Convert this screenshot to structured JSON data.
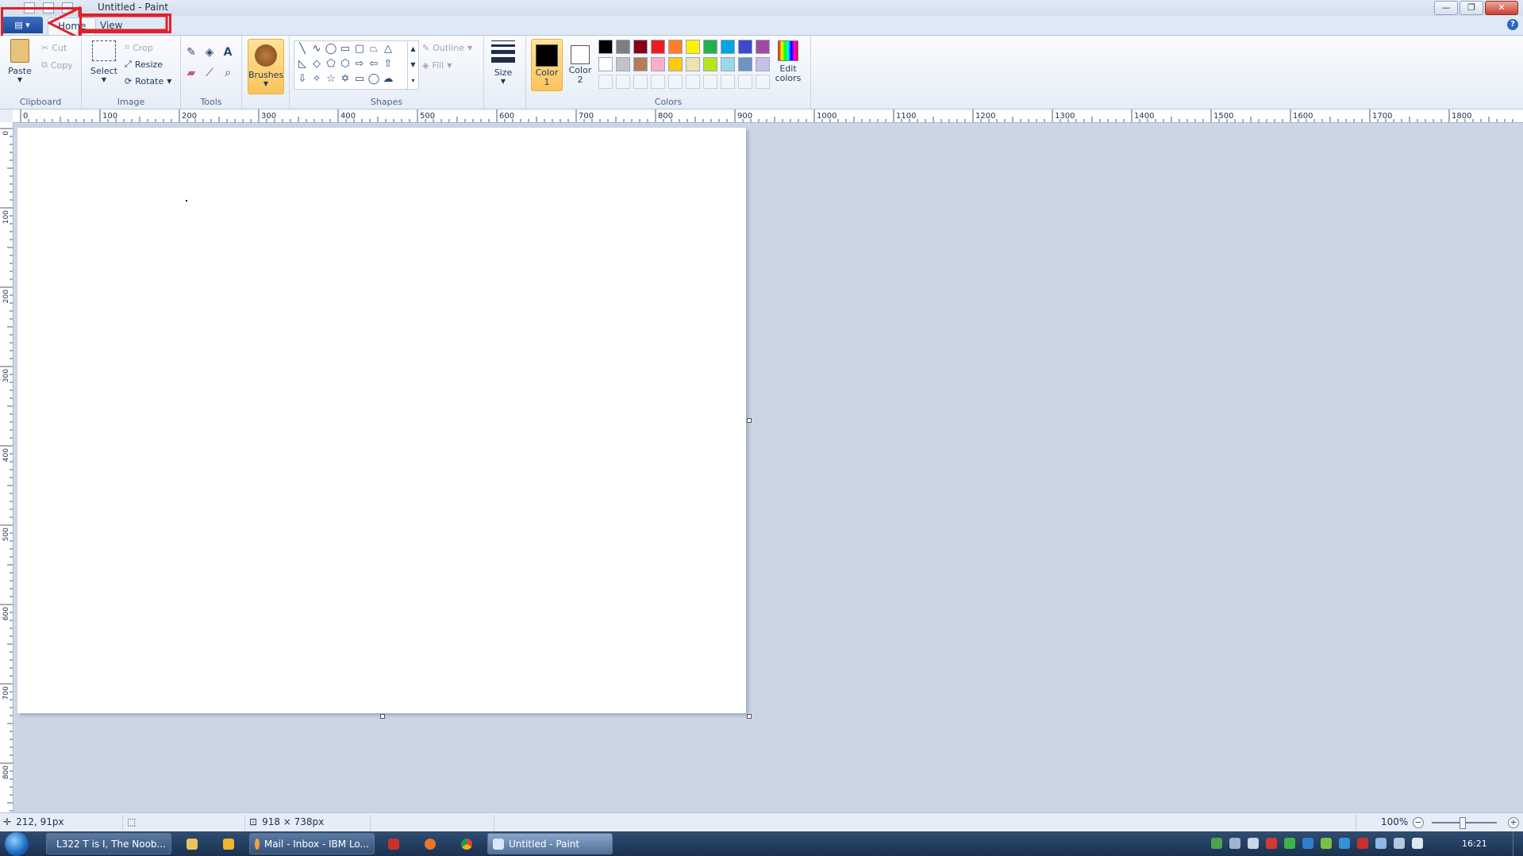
{
  "window": {
    "title": "Untitled - Paint",
    "controls": [
      "—",
      "❐",
      "✕"
    ]
  },
  "tabs": {
    "app_menu": "▤ ▾",
    "home": "Home",
    "view": "View",
    "help": "?"
  },
  "ribbon": {
    "clipboard": {
      "label": "Clipboard",
      "paste": "Paste",
      "cut": "Cut",
      "copy": "Copy"
    },
    "image": {
      "label": "Image",
      "select": "Select",
      "crop": "Crop",
      "resize": "Resize",
      "rotate": "Rotate"
    },
    "tools": {
      "label": "Tools"
    },
    "brushes": {
      "label": "Brushes"
    },
    "shapes": {
      "label": "Shapes",
      "outline": "Outline",
      "fill": "Fill"
    },
    "size": {
      "label": "Size"
    },
    "colors": {
      "label": "Colors",
      "color1": "Color 1",
      "color2": "Color 2",
      "edit_colors": "Edit colors",
      "color1_value": "#000000",
      "color2_value": "#ffffff",
      "palette": [
        "#000000",
        "#7f7f7f",
        "#880015",
        "#ed1c24",
        "#ff7f27",
        "#fff200",
        "#22b14c",
        "#00a2e8",
        "#3f48cc",
        "#a349a4",
        "#ffffff",
        "#c3c3c3",
        "#b97a57",
        "#ffaec9",
        "#ffc90e",
        "#efe4b0",
        "#b5e61d",
        "#99d9ea",
        "#7092be",
        "#c8bfe7"
      ]
    }
  },
  "rulers": {
    "horizontal": [
      "0",
      "100",
      "200",
      "300",
      "400",
      "500",
      "600",
      "700",
      "800",
      "900",
      "1000",
      "1100",
      "1200",
      "1300",
      "1400",
      "1500",
      "1600",
      "1700",
      "1800"
    ],
    "vertical": [
      "0",
      "100",
      "200",
      "300",
      "400",
      "500",
      "600",
      "700",
      "800"
    ]
  },
  "status": {
    "cursor_position": "212, 91px",
    "canvas_size": "918 × 738px",
    "zoom": "100%"
  },
  "taskbar": {
    "items": [
      {
        "label": "L322 T is I, The Noob...",
        "icon": "browser-icon",
        "color": "#4c9be0"
      },
      {
        "label": "Mail - Inbox - IBM Lo...",
        "icon": "mail-icon",
        "color": "#f2a33a"
      },
      {
        "label": "Untitled - Paint",
        "icon": "paint-icon",
        "color": "#d9e6f5"
      }
    ],
    "clock": "16:21"
  },
  "annotation": {
    "color": "#e0202a"
  }
}
